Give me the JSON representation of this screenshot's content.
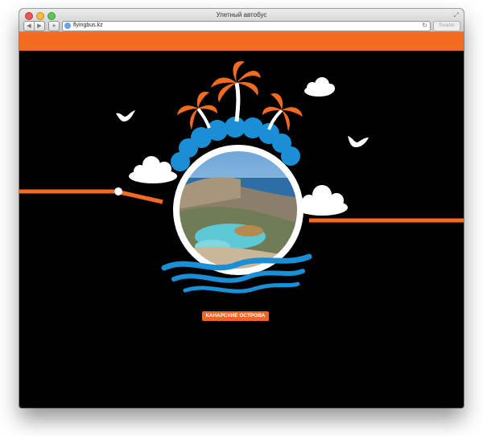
{
  "browser": {
    "title": "Улетный автобус",
    "url": "flyingbus.kz",
    "reader_label": "Reader",
    "add_tab_label": "+"
  },
  "page": {
    "destination_label": "КАНАРСКИЕ ОСТРОВА"
  },
  "colors": {
    "accent": "#f26b21",
    "sky_blue": "#1a8fd6",
    "background": "#000000"
  }
}
